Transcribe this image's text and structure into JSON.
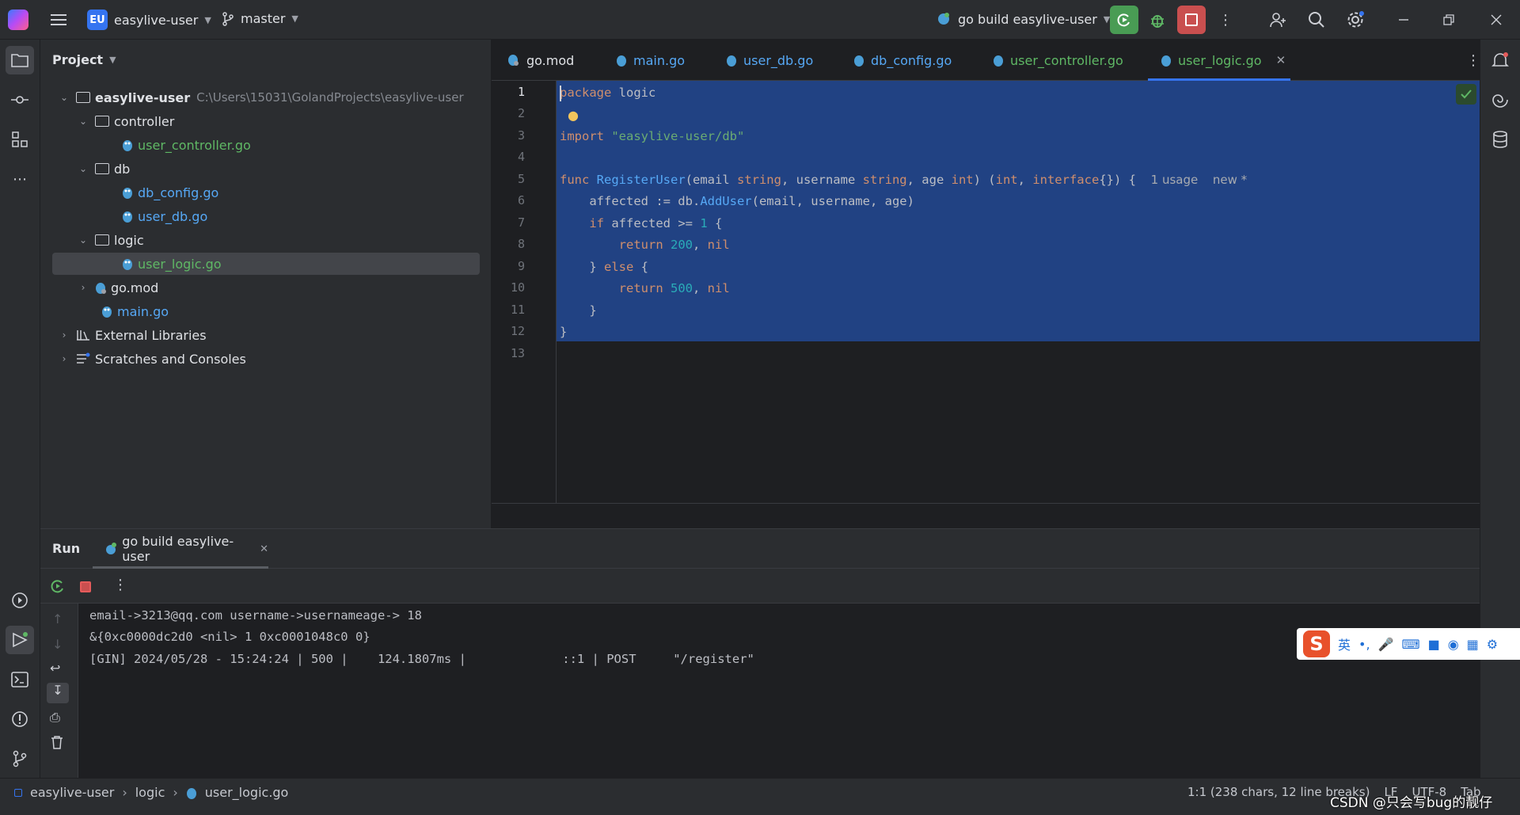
{
  "topbar": {
    "project_badge": "EU",
    "project_name": "easylive-user",
    "branch": "master",
    "run_config": "go build easylive-user"
  },
  "sidebar_icons": [
    "folder-icon",
    "commit-icon",
    "structure-icon",
    "more-icon"
  ],
  "project_panel": {
    "title": "Project",
    "root": {
      "name": "easylive-user",
      "path": "C:\\Users\\15031\\GolandProjects\\easylive-user"
    },
    "items": [
      {
        "label": "controller"
      },
      {
        "label": "user_controller.go"
      },
      {
        "label": "db"
      },
      {
        "label": "db_config.go"
      },
      {
        "label": "user_db.go"
      },
      {
        "label": "logic"
      },
      {
        "label": "user_logic.go"
      },
      {
        "label": "go.mod"
      },
      {
        "label": "main.go"
      },
      {
        "label": "External Libraries"
      },
      {
        "label": "Scratches and Consoles"
      }
    ]
  },
  "editor_tabs": [
    {
      "label": "go.mod"
    },
    {
      "label": "main.go"
    },
    {
      "label": "user_db.go"
    },
    {
      "label": "db_config.go"
    },
    {
      "label": "user_controller.go"
    },
    {
      "label": "user_logic.go"
    }
  ],
  "editor": {
    "line_numbers": [
      "1",
      "2",
      "3",
      "4",
      "5",
      "6",
      "7",
      "8",
      "9",
      "10",
      "11",
      "12",
      "13"
    ],
    "code": {
      "l1_kw": "package",
      "l1_rest": " logic",
      "l3_kw": "import",
      "l3_str": "\"easylive-user/db\"",
      "l5_kw": "func",
      "l5_fn": "RegisterUser",
      "l5_a": "(email ",
      "l5_t1": "string",
      "l5_b": ", username ",
      "l5_t2": "string",
      "l5_c": ", age ",
      "l5_t3": "int",
      "l5_d": ") (",
      "l5_t4": "int",
      "l5_e": ", ",
      "l5_t5": "interface",
      "l5_f": "{}) {",
      "l5_hint1": "1 usage",
      "l5_hint2": "new *",
      "l6_a": "    affected := db.",
      "l6_fn": "AddUser",
      "l6_b": "(email, username, age)",
      "l7_kw": "if",
      "l7_a": " affected >= ",
      "l7_num": "1",
      "l7_b": " {",
      "l8_kw": "return",
      "l8_num": "200",
      "l8_nil": "nil",
      "l9_a": "    } ",
      "l9_kw": "else",
      "l9_b": " {",
      "l10_kw": "return",
      "l10_num": "500",
      "l10_nil": "nil",
      "l11": "    }",
      "l12": "}"
    }
  },
  "run_panel": {
    "title": "Run",
    "tab": "go build easylive-user",
    "output": [
      "email->3213@qq.com username->usernameage-> 18",
      "&{0xc0000dc2d0 <nil> 1 0xc0001048c0 0}",
      "[GIN] 2024/05/28 - 15:24:24 | 500 |    124.1807ms |             ::1 | POST     \"/register\""
    ]
  },
  "statusbar": {
    "breadcrumb": [
      "easylive-user",
      "logic",
      "user_logic.go"
    ],
    "position": "1:1 (238 chars, 12 line breaks)",
    "line_sep": "LF",
    "encoding": "UTF-8",
    "indent": "Tab",
    "watermark": "CSDN @只会写bug的靓仔"
  },
  "ime": {
    "lang": "英",
    "punct": "•,"
  },
  "colors": {
    "accent": "#3574f0",
    "selection": "#214283",
    "green_file": "#5fb865",
    "run_green": "#499c54",
    "stop_red": "#c94f4f"
  }
}
